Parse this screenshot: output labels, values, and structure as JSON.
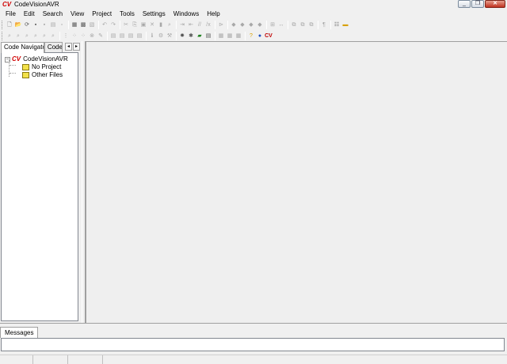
{
  "window": {
    "title": "CodeVisionAVR",
    "app_icon_glyph": "CV",
    "controls": [
      "_",
      "❐",
      "✕"
    ]
  },
  "menubar": {
    "items": [
      "File",
      "Edit",
      "Search",
      "View",
      "Project",
      "Tools",
      "Settings",
      "Windows",
      "Help"
    ]
  },
  "toolbar1": [
    {
      "icon": "new-file-icon",
      "glyph": "🗋",
      "enabled": true
    },
    {
      "icon": "open-file-icon",
      "glyph": "📂",
      "enabled": true
    },
    {
      "icon": "reopen-icon",
      "glyph": "⟳",
      "enabled": true
    },
    {
      "icon": "save-icon",
      "glyph": "▪",
      "enabled": true
    },
    {
      "icon": "save-all-icon",
      "glyph": "▪",
      "enabled": false
    },
    {
      "icon": "print-icon",
      "glyph": "▤",
      "enabled": false
    },
    {
      "icon": "close-file-icon",
      "glyph": "▫",
      "enabled": false
    },
    {
      "icon": "build-icon",
      "glyph": "▦",
      "enabled": true
    },
    {
      "icon": "compile-icon",
      "glyph": "▩",
      "enabled": true
    },
    {
      "icon": "print-preview-icon",
      "glyph": "▧",
      "enabled": false
    },
    {
      "icon": "undo-icon",
      "glyph": "↶",
      "enabled": false
    },
    {
      "icon": "redo-icon",
      "glyph": "↷",
      "enabled": false
    },
    {
      "icon": "cut-icon",
      "glyph": "✂",
      "enabled": false
    },
    {
      "icon": "copy-icon",
      "glyph": "⎘",
      "enabled": false
    },
    {
      "icon": "paste-icon",
      "glyph": "▣",
      "enabled": false
    },
    {
      "icon": "delete-icon",
      "glyph": "✕",
      "enabled": false
    },
    {
      "icon": "select-all-icon",
      "glyph": "▮",
      "enabled": false
    },
    {
      "icon": "find-icon",
      "glyph": "⌕",
      "enabled": false
    },
    {
      "icon": "indent-icon",
      "glyph": "⇥",
      "enabled": false
    },
    {
      "icon": "unindent-icon",
      "glyph": "⇤",
      "enabled": false
    },
    {
      "icon": "comment-icon",
      "glyph": "//",
      "enabled": false
    },
    {
      "icon": "uncomment-icon",
      "glyph": "/x",
      "enabled": false
    },
    {
      "icon": "toggle-bookmark-icon",
      "glyph": "⊳",
      "enabled": false
    },
    {
      "icon": "bookmark-prev-icon",
      "glyph": "◆",
      "enabled": false
    },
    {
      "icon": "bookmark-next-icon",
      "glyph": "◆",
      "enabled": false
    },
    {
      "icon": "goto-line-icon",
      "glyph": "◆",
      "enabled": false
    },
    {
      "icon": "match-brace-icon",
      "glyph": "◆",
      "enabled": false
    },
    {
      "icon": "column-select-icon",
      "glyph": "⊞",
      "enabled": false
    },
    {
      "icon": "split-view-icon",
      "glyph": "↔",
      "enabled": false
    },
    {
      "icon": "window-tile-icon",
      "glyph": "⧉",
      "enabled": false
    },
    {
      "icon": "window-cascade-icon",
      "glyph": "⧉",
      "enabled": false
    },
    {
      "icon": "window-arrange-icon",
      "glyph": "⧉",
      "enabled": false
    },
    {
      "icon": "paragraph-icon",
      "glyph": "¶",
      "enabled": false
    },
    {
      "icon": "options-icon",
      "glyph": "☷",
      "enabled": true
    },
    {
      "icon": "layout-icon",
      "glyph": "▬",
      "enabled": true
    }
  ],
  "toolbar2": [
    {
      "icon": "find-in-files-icon",
      "glyph": "⌕",
      "enabled": false
    },
    {
      "icon": "find-next-icon",
      "glyph": "⌕",
      "enabled": false
    },
    {
      "icon": "find-prev-icon",
      "glyph": "⌕",
      "enabled": false
    },
    {
      "icon": "replace-icon",
      "glyph": "⌕",
      "enabled": false
    },
    {
      "icon": "replace-all-icon",
      "glyph": "⌕",
      "enabled": false
    },
    {
      "icon": "replace-in-files-icon",
      "glyph": "⌕",
      "enabled": false
    },
    {
      "icon": "goto-icon",
      "glyph": "⋮",
      "enabled": false
    },
    {
      "icon": "error-next-icon",
      "glyph": "⁘",
      "enabled": false
    },
    {
      "icon": "error-prev-icon",
      "glyph": "⁘",
      "enabled": false
    },
    {
      "icon": "stop-icon",
      "glyph": "⊗",
      "enabled": false
    },
    {
      "icon": "tool-icon",
      "glyph": "✎",
      "enabled": false
    },
    {
      "icon": "project-config-icon",
      "glyph": "▤",
      "enabled": false
    },
    {
      "icon": "project-add-icon",
      "glyph": "▤",
      "enabled": false
    },
    {
      "icon": "project-remove-icon",
      "glyph": "▤",
      "enabled": false
    },
    {
      "icon": "project-close-icon",
      "glyph": "▤",
      "enabled": false
    },
    {
      "icon": "info-icon",
      "glyph": "ℹ",
      "enabled": false
    },
    {
      "icon": "configure-icon",
      "glyph": "⚙",
      "enabled": false
    },
    {
      "icon": "make-icon",
      "glyph": "⚒",
      "enabled": false
    },
    {
      "icon": "codewizard-icon",
      "glyph": "✹",
      "enabled": true
    },
    {
      "icon": "debugger-icon",
      "glyph": "✱",
      "enabled": true
    },
    {
      "icon": "chip-programmer-icon",
      "glyph": "▰",
      "enabled": true
    },
    {
      "icon": "terminal-icon",
      "glyph": "▤",
      "enabled": true
    },
    {
      "icon": "lcd-editor-icon",
      "glyph": "▦",
      "enabled": false
    },
    {
      "icon": "char-map-icon",
      "glyph": "▦",
      "enabled": false
    },
    {
      "icon": "font-editor-icon",
      "glyph": "▦",
      "enabled": false
    },
    {
      "icon": "help-icon",
      "glyph": "?",
      "enabled": true
    },
    {
      "icon": "web-icon",
      "glyph": "●",
      "enabled": true
    },
    {
      "icon": "about-cvavr-icon",
      "glyph": "CV",
      "enabled": true
    }
  ],
  "navigator": {
    "tabs": [
      "Code Navigator",
      "Code T"
    ],
    "tab_scroll": [
      "◂",
      "▸"
    ],
    "tree": {
      "expander": "−",
      "root_label": "CodeVisionAVR",
      "children": [
        "No Project",
        "Other Files"
      ]
    }
  },
  "messages": {
    "tab_label": "Messages"
  }
}
